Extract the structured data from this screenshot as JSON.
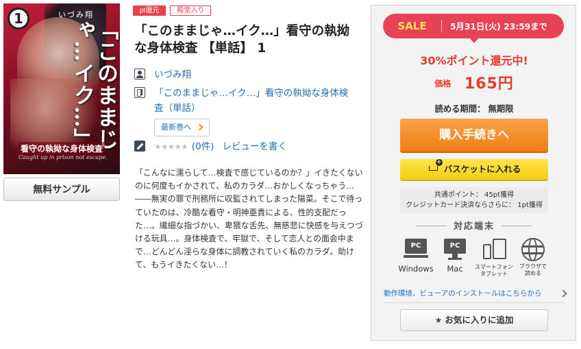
{
  "cover": {
    "volume": "1",
    "author": "いづみ翔",
    "title_vertical": "「このままじゃ…イク…」",
    "subtitle": "看守の執拗な身体検査",
    "english_subtitle": "Caught up in prison not escape."
  },
  "sample_button": "無料サンプル",
  "tags": [
    "pt還元",
    "殿堂入り"
  ],
  "title": "「このままじゃ…イク…」看守の執拗な身体検査 【単話】 1",
  "author": {
    "icon": "person-icon",
    "name": "いづみ翔"
  },
  "series": {
    "icon": "book-icon",
    "name": "「このままじゃ…イク…」看守の執拗な身体検査（単話）"
  },
  "latest_button": "最新巻へ",
  "review": {
    "icon": "pen-icon",
    "stars": "★★★★★",
    "count": "(0件)",
    "write_label": "レビューを書く"
  },
  "description": "「こんなに濡らして…検査で感じているのか？」イきたくないのに何度もイかされて、私のカラダ…おかしくなっちゃう…――無実の罪で刑務所に収監されてしまった陽菜。そこで待っていたのは、冷酷な看守・明神亜貴による、性的支配だった…。繊細な指づかい、卑猥な舌先、無慈悲に快感を与えつづける玩具…。身体検査で、牢獄で、そして恋人との面会中まで…どんどん淫らな身体に調教されていく私のカラダ。助けて、もうイきたくない…！",
  "purchase": {
    "sale_label": "SALE",
    "sale_until": "5月31日(火) 23:59まで",
    "point_back": "30%ポイント還元中!",
    "price_label": "価格",
    "price_value": "165円",
    "period": "読める期間： 無期限",
    "buy_button": "購入手続きへ",
    "basket_button": "バスケットに入れる",
    "points_line1": "共通ポイント： 45pt獲得",
    "points_line2": "クレジットカード決済ならさらに： 1pt獲得",
    "devices_title": "対応端末",
    "devices": [
      {
        "icon": "pc-windows-icon",
        "label": "Windows"
      },
      {
        "icon": "pc-mac-icon",
        "label": "Mac"
      },
      {
        "icon": "smartphone-tablet-icon",
        "label": "スマートフォン\nタブレット"
      },
      {
        "icon": "globe-icon",
        "label": "ブラウザで\n読める"
      }
    ],
    "env_link": "動作環境、ビューアのインストールはこちらから",
    "favorite_button": "お気に入りに追加"
  },
  "colors": {
    "accent_red": "#e84257",
    "price_red": "#e53b2a",
    "buy_orange": "#f07f12",
    "basket_yellow": "#f6ce12",
    "link_blue": "#1f6fb5"
  }
}
